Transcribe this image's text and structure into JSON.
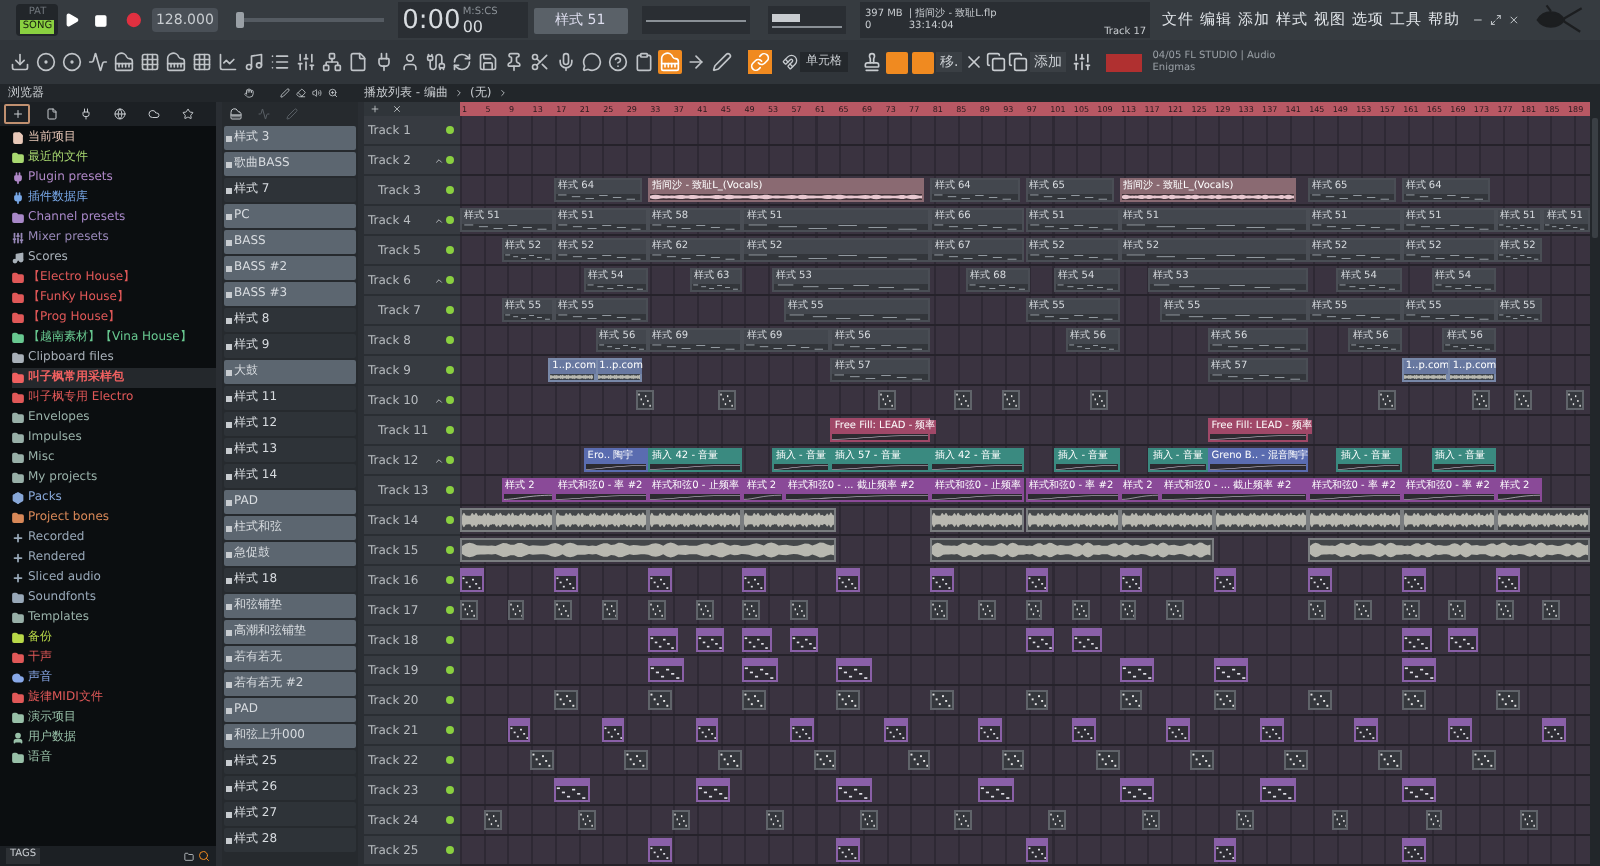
{
  "transport": {
    "modes": [
      {
        "label": "PAT",
        "selected": false
      },
      {
        "label": "SONG",
        "selected": true
      }
    ],
    "tempo": "128.000",
    "time": "0:00",
    "time_cs": "00",
    "time_unit": "M:S:CS",
    "pattern": "样式 51",
    "master_pitch": {
      "level": 0
    }
  },
  "info": {
    "memory": "397 MB",
    "cpu": "0",
    "file": "| 指间沙 - 致耻L.flp",
    "time": "33:14:04",
    "target": "Track 17"
  },
  "menu": [
    "文件",
    "编辑",
    "添加",
    "样式",
    "视图",
    "选项",
    "工具",
    "帮助"
  ],
  "tools": [
    {
      "kind": "download",
      "on": false
    },
    {
      "kind": "knob",
      "on": false
    },
    {
      "kind": "knob",
      "on": false
    },
    {
      "kind": "wave",
      "on": false
    },
    {
      "kind": "piano",
      "on": false
    },
    {
      "kind": "grid",
      "on": false
    },
    {
      "kind": "piano",
      "on": false
    },
    {
      "kind": "grid",
      "on": false
    },
    {
      "kind": "chart",
      "on": false
    },
    {
      "kind": "music",
      "on": false
    },
    {
      "kind": "list",
      "on": false
    },
    {
      "kind": "mixer",
      "on": false
    },
    {
      "kind": "tree",
      "on": false
    },
    {
      "kind": "file",
      "on": false
    },
    {
      "kind": "plug",
      "on": false
    },
    {
      "kind": "person",
      "on": false
    },
    {
      "kind": "cable",
      "on": false
    },
    {
      "kind": "refresh",
      "on": false
    },
    {
      "kind": "save",
      "on": false
    },
    {
      "kind": "pin",
      "on": false
    },
    {
      "kind": "scissors",
      "on": false
    },
    {
      "kind": "mic",
      "on": false
    },
    {
      "kind": "chat",
      "on": false
    },
    {
      "kind": "help",
      "on": false
    },
    {
      "kind": "clipboard",
      "on": false
    },
    {
      "kind": "piano",
      "on": true
    },
    {
      "kind": "arrow",
      "on": false
    },
    {
      "kind": "pen",
      "on": false
    }
  ],
  "edit_tools": {
    "link_on": true,
    "snap": "单元格",
    "toggles": [
      {
        "on": true
      },
      {
        "on": true
      }
    ],
    "move": "移.",
    "add": "添加"
  },
  "hint": {
    "line1": "04/05  FL STUDIO | Audio",
    "line2": "Enigmas"
  },
  "browser": {
    "title": "浏览器",
    "tabs": [
      {
        "kind": "browse",
        "selected": true
      },
      {
        "kind": "file",
        "selected": false
      },
      {
        "kind": "plug",
        "selected": false
      },
      {
        "kind": "globe",
        "selected": false
      },
      {
        "kind": "cloud",
        "selected": false
      },
      {
        "kind": "star",
        "selected": false
      }
    ],
    "items": [
      {
        "label": "当前项目",
        "kind": "file",
        "color": "#e8c8b8",
        "selected": false
      },
      {
        "label": "最近的文件",
        "kind": "folder",
        "color": "#a8d870",
        "selected": false
      },
      {
        "label": "Plugin presets",
        "kind": "plug",
        "color": "#b088c8",
        "selected": false
      },
      {
        "label": "插件数据库",
        "kind": "plug",
        "color": "#78a8e8",
        "selected": false
      },
      {
        "label": "Channel presets",
        "kind": "folder",
        "color": "#a888c8",
        "selected": false
      },
      {
        "label": "Mixer presets",
        "kind": "mixer",
        "color": "#9888b8",
        "selected": false
      },
      {
        "label": "Scores",
        "kind": "music",
        "color": "#a8b0b8",
        "selected": false
      },
      {
        "label": "【Electro House】",
        "kind": "folder",
        "color": "#e05858",
        "selected": false
      },
      {
        "label": "【FunKy House】",
        "kind": "folder",
        "color": "#e05858",
        "selected": false
      },
      {
        "label": "【Prog House】",
        "kind": "folder",
        "color": "#e05858",
        "selected": false
      },
      {
        "label": "【越南素材】【Vina House】",
        "kind": "folder",
        "color": "#68c890",
        "selected": false
      },
      {
        "label": "Clipboard files",
        "kind": "folder",
        "color": "#a8b0b8",
        "selected": false
      },
      {
        "label": "叫子枫常用采样包",
        "kind": "folder",
        "color": "#f06060",
        "selected": true
      },
      {
        "label": "叫子枫专用 Electro",
        "kind": "folder",
        "color": "#e05858",
        "selected": false
      },
      {
        "label": "Envelopes",
        "kind": "folder",
        "color": "#98b0a8",
        "selected": false
      },
      {
        "label": "Impulses",
        "kind": "folder",
        "color": "#98b0a8",
        "selected": false
      },
      {
        "label": "Misc",
        "kind": "folder",
        "color": "#98b0a8",
        "selected": false
      },
      {
        "label": "My projects",
        "kind": "folder",
        "color": "#98b0a8",
        "selected": false
      },
      {
        "label": "Packs",
        "kind": "pack",
        "color": "#88a8d8",
        "selected": false
      },
      {
        "label": "Project bones",
        "kind": "folder",
        "color": "#d88858",
        "selected": false
      },
      {
        "label": "Recorded",
        "kind": "plus",
        "color": "#98a8b8",
        "selected": false
      },
      {
        "label": "Rendered",
        "kind": "plus",
        "color": "#98a8b8",
        "selected": false
      },
      {
        "label": "Sliced audio",
        "kind": "plus",
        "color": "#98a8b8",
        "selected": false
      },
      {
        "label": "Soundfonts",
        "kind": "folder",
        "color": "#98a8b8",
        "selected": false
      },
      {
        "label": "Templates",
        "kind": "folder",
        "color": "#98b0a8",
        "selected": false
      },
      {
        "label": "备份",
        "kind": "folder",
        "color": "#b8d848",
        "selected": false
      },
      {
        "label": "干声",
        "kind": "folder",
        "color": "#e05858",
        "selected": false
      },
      {
        "label": "声音",
        "kind": "cloud",
        "color": "#88a8e8",
        "selected": false
      },
      {
        "label": "旋律MIDI文件",
        "kind": "folder",
        "color": "#e05858",
        "selected": false
      },
      {
        "label": "演示项目",
        "kind": "folder",
        "color": "#98c0a8",
        "selected": false
      },
      {
        "label": "用户数据",
        "kind": "person",
        "color": "#98c0a8",
        "selected": false
      },
      {
        "label": "语音",
        "kind": "folder",
        "color": "#98c0a8",
        "selected": false
      }
    ],
    "footer": "TAGS"
  },
  "patterns": [
    {
      "label": "样式 3",
      "color": "#5c6670"
    },
    {
      "label": "歌曲BASS",
      "color": "#5c6670"
    },
    {
      "label": "样式 7",
      "color": "#2e3338"
    },
    {
      "label": "PC",
      "color": "#5c6670"
    },
    {
      "label": "BASS",
      "color": "#5c6670"
    },
    {
      "label": "BASS #2",
      "color": "#5c6670"
    },
    {
      "label": "BASS #3",
      "color": "#5c6670"
    },
    {
      "label": "样式 8",
      "color": "#2e3338"
    },
    {
      "label": "样式 9",
      "color": "#2e3338"
    },
    {
      "label": "大鼓",
      "color": "#5c6670"
    },
    {
      "label": "样式 11",
      "color": "#2e3338"
    },
    {
      "label": "样式 12",
      "color": "#2e3338"
    },
    {
      "label": "样式 13",
      "color": "#2e3338"
    },
    {
      "label": "样式 14",
      "color": "#2e3338"
    },
    {
      "label": "PAD",
      "color": "#5c6670"
    },
    {
      "label": "柱式和弦",
      "color": "#5c6670"
    },
    {
      "label": "急促鼓",
      "color": "#5c6670"
    },
    {
      "label": "样式 18",
      "color": "#2e3338"
    },
    {
      "label": "和弦铺垫",
      "color": "#5c6670"
    },
    {
      "label": "高潮和弦铺垫",
      "color": "#5c6670"
    },
    {
      "label": "若有若无",
      "color": "#5c6670"
    },
    {
      "label": "若有若无 #2",
      "color": "#5c6670"
    },
    {
      "label": "PAD",
      "color": "#5c6670"
    },
    {
      "label": "和弦上升000",
      "color": "#5c6670"
    },
    {
      "label": "样式 25",
      "color": "#2e3338"
    },
    {
      "label": "样式 26",
      "color": "#2e3338"
    },
    {
      "label": "样式 27",
      "color": "#2e3338"
    },
    {
      "label": "样式 28",
      "color": "#2e3338"
    }
  ],
  "playlist": {
    "title": "播放列表 - 编曲",
    "arrangement": "(无)",
    "ruler": [
      "1",
      "5",
      "9",
      "13",
      "17",
      "21",
      "25",
      "29",
      "33",
      "37",
      "41",
      "45",
      "49",
      "53",
      "57",
      "61",
      "65",
      "69",
      "73",
      "77",
      "81",
      "85",
      "89",
      "93",
      "97",
      "101",
      "105",
      "109",
      "113",
      "117",
      "121",
      "125",
      "129",
      "133",
      "137",
      "141",
      "145",
      "149",
      "153",
      "157",
      "161",
      "165",
      "169",
      "173",
      "177",
      "181",
      "185",
      "189"
    ],
    "tracks": [
      {
        "name": "Track 1"
      },
      {
        "name": "Track 2",
        "children": [
          {
            "name": "Track 3",
            "clips": [
              {
                "kind": "pattern",
                "label": "样式 64"
              },
              {
                "kind": "audio",
                "label": "指间沙 - 致耻L_(Vocals)"
              },
              {
                "kind": "pattern",
                "label": "样式 64"
              },
              {
                "kind": "pattern",
                "label": "样式 65"
              },
              {
                "kind": "audio",
                "label": "指间沙 - 致耻L_(Vocals)"
              },
              {
                "kind": "pattern",
                "label": "样式 65"
              },
              {
                "kind": "pattern",
                "label": "样式 64"
              }
            ]
          }
        ]
      },
      {
        "name": "Track 4",
        "clips": [
          {
            "kind": "pattern",
            "label": "样式 51"
          },
          {
            "kind": "pattern",
            "label": "样式 51"
          },
          {
            "kind": "pattern",
            "label": "样式 58"
          },
          {
            "kind": "pattern",
            "label": "样式 51"
          },
          {
            "kind": "pattern",
            "label": "样式 66"
          },
          {
            "kind": "pattern",
            "label": "样式 51"
          },
          {
            "kind": "pattern",
            "label": "样式 51"
          },
          {
            "kind": "pattern",
            "label": "样式 51"
          },
          {
            "kind": "pattern",
            "label": "样式 51"
          },
          {
            "kind": "pattern",
            "label": "样式 51"
          },
          {
            "kind": "pattern",
            "label": "样式 51"
          }
        ],
        "children": [
          {
            "name": "Track 5",
            "clips": [
              {
                "kind": "pattern",
                "label": "样式 52"
              },
              {
                "kind": "pattern",
                "label": "样式 52"
              },
              {
                "kind": "pattern",
                "label": "样式 62"
              },
              {
                "kind": "pattern",
                "label": "样式 52"
              },
              {
                "kind": "pattern",
                "label": "样式 67"
              },
              {
                "kind": "pattern",
                "label": "样式 52"
              },
              {
                "kind": "pattern",
                "label": "样式 52"
              },
              {
                "kind": "pattern",
                "label": "样式 52"
              },
              {
                "kind": "pattern",
                "label": "样式 52"
              },
              {
                "kind": "pattern",
                "label": "样式 52"
              }
            ]
          }
        ]
      },
      {
        "name": "Track 6",
        "clips": [
          {
            "kind": "pattern",
            "label": "样式 54"
          },
          {
            "kind": "pattern",
            "label": "样式 63"
          },
          {
            "kind": "pattern",
            "label": "样式 53"
          },
          {
            "kind": "pattern",
            "label": "样式 68"
          },
          {
            "kind": "pattern",
            "label": "样式 54"
          },
          {
            "kind": "pattern",
            "label": "样式 53"
          },
          {
            "kind": "pattern",
            "label": "样式 54"
          },
          {
            "kind": "pattern",
            "label": "样式 54"
          }
        ],
        "children": [
          {
            "name": "Track 7",
            "clips": [
              {
                "kind": "pattern",
                "label": "样式 55"
              },
              {
                "kind": "pattern",
                "label": "样式 55"
              },
              {
                "kind": "pattern",
                "label": "样式 55"
              },
              {
                "kind": "pattern",
                "label": "样式 55"
              },
              {
                "kind": "pattern",
                "label": "样式 55"
              },
              {
                "kind": "pattern",
                "label": "样式 55"
              },
              {
                "kind": "pattern",
                "label": "样式 55"
              },
              {
                "kind": "pattern",
                "label": "样式 55"
              }
            ]
          }
        ]
      },
      {
        "name": "Track 8",
        "clips": [
          {
            "kind": "pattern",
            "label": "样式 56"
          },
          {
            "kind": "pattern",
            "label": "样式 69"
          },
          {
            "kind": "pattern",
            "label": "样式 69"
          },
          {
            "kind": "pattern",
            "label": "样式 56"
          },
          {
            "kind": "pattern",
            "label": "样式 56"
          },
          {
            "kind": "pattern",
            "label": "样式 56"
          },
          {
            "kind": "pattern",
            "label": "样式 56"
          },
          {
            "kind": "pattern",
            "label": "样式 56"
          }
        ]
      },
      {
        "name": "Track 9",
        "clips": [
          {
            "kind": "sample",
            "label": "1..p.com"
          },
          {
            "kind": "sample",
            "label": "1..p.com"
          },
          {
            "kind": "pattern",
            "label": "样式 57"
          },
          {
            "kind": "pattern",
            "label": "样式 57"
          },
          {
            "kind": "sample",
            "label": "1..p.com"
          },
          {
            "kind": "sample",
            "label": "1..p.com"
          }
        ]
      },
      {
        "name": "Track 10",
        "clips": [
          {
            "kind": "mini"
          },
          {
            "kind": "mini"
          },
          {
            "kind": "mini"
          },
          {
            "kind": "mini"
          },
          {
            "kind": "mini"
          },
          {
            "kind": "mini"
          },
          {
            "kind": "mini"
          },
          {
            "kind": "mini"
          },
          {
            "kind": "mini"
          },
          {
            "kind": "mini"
          }
        ],
        "children": [
          {
            "name": "Track 11",
            "clips": [
              {
                "kind": "automation",
                "label": "Free Fill: LEAD - 频率",
                "color": "#a04868"
              },
              {
                "kind": "automation",
                "label": "Free Fill: LEAD - 频率",
                "color": "#a04868"
              }
            ]
          }
        ]
      },
      {
        "name": "Track 12",
        "clips": [
          {
            "kind": "automation",
            "label": "Ero.. 陶宇",
            "color": "#5a6cb0"
          },
          {
            "kind": "automation",
            "label": "插入 42 - 音量",
            "color": "#3a8a80"
          },
          {
            "kind": "automation",
            "label": "插入 - 音量",
            "color": "#3a8a80"
          },
          {
            "kind": "automation",
            "label": "插入 57 - 音量",
            "color": "#3a8a80"
          },
          {
            "kind": "automation",
            "label": "插入 42 - 音量",
            "color": "#3a8a80"
          },
          {
            "kind": "automation",
            "label": "插入 - 音量",
            "color": "#3a8a80"
          },
          {
            "kind": "automation",
            "label": "插入 - 音量",
            "color": "#3a8a80"
          },
          {
            "kind": "automation",
            "label": "Greno B.. - 混音陶宇",
            "color": "#5a6cb0"
          },
          {
            "kind": "automation",
            "label": "插入 - 音量",
            "color": "#3a8a80"
          },
          {
            "kind": "automation",
            "label": "插入 - 音量",
            "color": "#3a8a80"
          }
        ],
        "children": [
          {
            "name": "Track 13",
            "clips": [
              {
                "kind": "automation",
                "label": "样式 2",
                "color": "#8a4a98"
              },
              {
                "kind": "automation",
                "label": "样式和弦0 - 率 #2",
                "color": "#8a4a98"
              },
              {
                "kind": "automation",
                "label": "样式和弦0 - 止频率",
                "color": "#8a4a98"
              },
              {
                "kind": "automation",
                "label": "样式 2",
                "color": "#8a4a98"
              },
              {
                "kind": "automation",
                "label": "样式和弦0 - ... 截止频率 #2",
                "color": "#8a4a98"
              },
              {
                "kind": "automation",
                "label": "样式和弦0 - 止频率",
                "color": "#8a4a98"
              },
              {
                "kind": "automation",
                "label": "样式和弦0 - 率 #2",
                "color": "#8a4a98"
              },
              {
                "kind": "automation",
                "label": "样式 2",
                "color": "#8a4a98"
              },
              {
                "kind": "automation",
                "label": "样式和弦0 - ... 截止频率 #2",
                "color": "#8a4a98"
              },
              {
                "kind": "automation",
                "label": "样式和弦0 - 率 #2",
                "color": "#8a4a98"
              },
              {
                "kind": "automation",
                "label": "样式和弦0 - 率 #2",
                "color": "#8a4a98"
              },
              {
                "kind": "automation",
                "label": "样式 2",
                "color": "#8a4a98"
              }
            ]
          }
        ]
      },
      {
        "name": "Track 14",
        "clips": [
          {
            "kind": "wave"
          },
          {
            "kind": "wave"
          },
          {
            "kind": "wave"
          },
          {
            "kind": "wave"
          },
          {
            "kind": "wave"
          },
          {
            "kind": "wave"
          },
          {
            "kind": "wave"
          },
          {
            "kind": "wave"
          },
          {
            "kind": "wave"
          },
          {
            "kind": "wave"
          },
          {
            "kind": "wave"
          }
        ]
      },
      {
        "name": "Track 15",
        "clips": [
          {
            "kind": "wave"
          },
          {
            "kind": "wave"
          },
          {
            "kind": "wave"
          }
        ]
      },
      {
        "name": "Track 16",
        "clips": [
          {
            "kind": "notes"
          },
          {
            "kind": "notes"
          },
          {
            "kind": "notes"
          },
          {
            "kind": "notes"
          },
          {
            "kind": "notes"
          },
          {
            "kind": "notes"
          },
          {
            "kind": "notes"
          },
          {
            "kind": "notes"
          },
          {
            "kind": "notes"
          },
          {
            "kind": "notes"
          },
          {
            "kind": "notes"
          },
          {
            "kind": "notes"
          }
        ]
      },
      {
        "name": "Track 17",
        "clips": [
          {
            "kind": "mini"
          },
          {
            "kind": "mini"
          },
          {
            "kind": "mini"
          },
          {
            "kind": "mini"
          },
          {
            "kind": "mini"
          },
          {
            "kind": "mini"
          },
          {
            "kind": "mini"
          },
          {
            "kind": "mini"
          },
          {
            "kind": "mini"
          },
          {
            "kind": "mini"
          },
          {
            "kind": "mini"
          },
          {
            "kind": "mini"
          },
          {
            "kind": "mini"
          },
          {
            "kind": "mini"
          },
          {
            "kind": "mini"
          },
          {
            "kind": "mini"
          },
          {
            "kind": "mini"
          },
          {
            "kind": "mini"
          },
          {
            "kind": "mini"
          },
          {
            "kind": "mini"
          }
        ]
      },
      {
        "name": "Track 18",
        "clips": [
          {
            "kind": "notes"
          },
          {
            "kind": "notes"
          },
          {
            "kind": "notes"
          },
          {
            "kind": "notes"
          },
          {
            "kind": "notes"
          },
          {
            "kind": "notes"
          },
          {
            "kind": "notes"
          },
          {
            "kind": "notes"
          }
        ]
      },
      {
        "name": "Track 19",
        "clips": [
          {
            "kind": "notes"
          },
          {
            "kind": "notes"
          },
          {
            "kind": "notes"
          },
          {
            "kind": "notes"
          },
          {
            "kind": "notes"
          },
          {
            "kind": "notes"
          }
        ]
      },
      {
        "name": "Track 20",
        "clips": [
          {
            "kind": "mini"
          },
          {
            "kind": "mini"
          },
          {
            "kind": "mini"
          },
          {
            "kind": "mini"
          },
          {
            "kind": "mini"
          },
          {
            "kind": "mini"
          },
          {
            "kind": "mini"
          },
          {
            "kind": "mini"
          },
          {
            "kind": "mini"
          },
          {
            "kind": "mini"
          },
          {
            "kind": "mini"
          }
        ]
      },
      {
        "name": "Track 21",
        "clips": [
          {
            "kind": "notes"
          },
          {
            "kind": "notes"
          },
          {
            "kind": "notes"
          },
          {
            "kind": "notes"
          },
          {
            "kind": "notes"
          },
          {
            "kind": "notes"
          },
          {
            "kind": "notes"
          },
          {
            "kind": "notes"
          },
          {
            "kind": "notes"
          },
          {
            "kind": "notes"
          },
          {
            "kind": "notes"
          },
          {
            "kind": "notes"
          }
        ]
      },
      {
        "name": "Track 22",
        "clips": [
          {
            "kind": "mini"
          },
          {
            "kind": "mini"
          },
          {
            "kind": "mini"
          },
          {
            "kind": "mini"
          },
          {
            "kind": "mini"
          },
          {
            "kind": "mini"
          },
          {
            "kind": "mini"
          },
          {
            "kind": "mini"
          },
          {
            "kind": "mini"
          },
          {
            "kind": "mini"
          },
          {
            "kind": "mini"
          }
        ]
      },
      {
        "name": "Track 23",
        "clips": [
          {
            "kind": "notes"
          },
          {
            "kind": "notes"
          },
          {
            "kind": "notes"
          },
          {
            "kind": "notes"
          },
          {
            "kind": "notes"
          },
          {
            "kind": "notes"
          },
          {
            "kind": "notes"
          }
        ]
      },
      {
        "name": "Track 24",
        "clips": [
          {
            "kind": "mini"
          },
          {
            "kind": "mini"
          },
          {
            "kind": "mini"
          },
          {
            "kind": "mini"
          },
          {
            "kind": "mini"
          },
          {
            "kind": "mini"
          },
          {
            "kind": "mini"
          },
          {
            "kind": "mini"
          },
          {
            "kind": "mini"
          },
          {
            "kind": "mini"
          },
          {
            "kind": "mini"
          },
          {
            "kind": "mini"
          }
        ]
      },
      {
        "name": "Track 25",
        "clips": [
          {
            "kind": "notes"
          },
          {
            "kind": "notes"
          },
          {
            "kind": "notes"
          },
          {
            "kind": "notes"
          },
          {
            "kind": "notes"
          }
        ]
      }
    ]
  }
}
